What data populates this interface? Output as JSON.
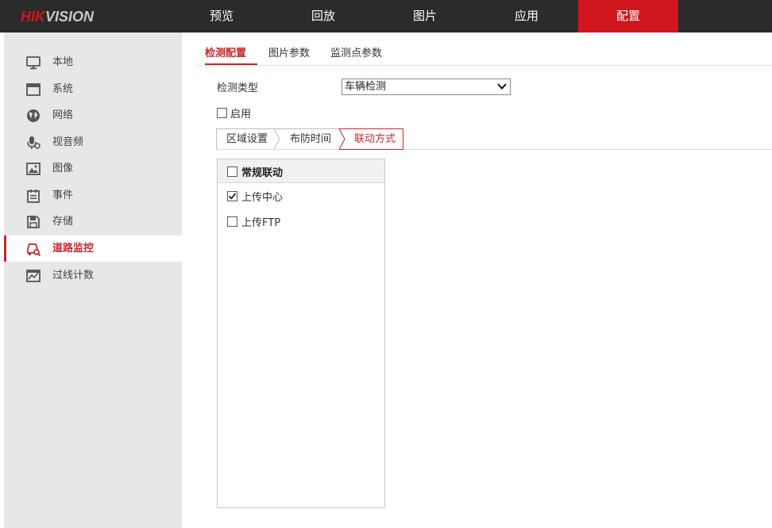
{
  "brand": {
    "logo_text": "HIKVISION",
    "accent_color": "#d2161e"
  },
  "topnav": {
    "items": [
      {
        "label": "预览"
      },
      {
        "label": "回放"
      },
      {
        "label": "图片"
      },
      {
        "label": "应用"
      },
      {
        "label": "配置",
        "active": true
      }
    ]
  },
  "sidebar": {
    "items": [
      {
        "label": "本地",
        "icon": "monitor-icon"
      },
      {
        "label": "系统",
        "icon": "window-icon"
      },
      {
        "label": "网络",
        "icon": "globe-icon"
      },
      {
        "label": "视音频",
        "icon": "microphone-camera-icon"
      },
      {
        "label": "图像",
        "icon": "image-icon"
      },
      {
        "label": "事件",
        "icon": "calendar-icon"
      },
      {
        "label": "存储",
        "icon": "floppy-disk-icon"
      },
      {
        "label": "道路监控",
        "icon": "vehicle-search-icon",
        "active": true
      },
      {
        "label": "过线计数",
        "icon": "chart-counter-icon"
      }
    ]
  },
  "subtabs": [
    {
      "label": "检测配置",
      "active": true
    },
    {
      "label": "图片参数"
    },
    {
      "label": "监测点参数"
    }
  ],
  "detection": {
    "type_label": "检测类型",
    "type_value": "车辆检测",
    "enable_label": "启用",
    "enable_checked": false
  },
  "steps": [
    {
      "label": "区域设置"
    },
    {
      "label": "布防时间"
    },
    {
      "label": "联动方式",
      "active": true
    }
  ],
  "linkage": {
    "header_label": "常规联动",
    "header_checked": false,
    "items": [
      {
        "label": "上传中心",
        "checked": true
      },
      {
        "label": "上传FTP",
        "checked": false
      }
    ]
  }
}
